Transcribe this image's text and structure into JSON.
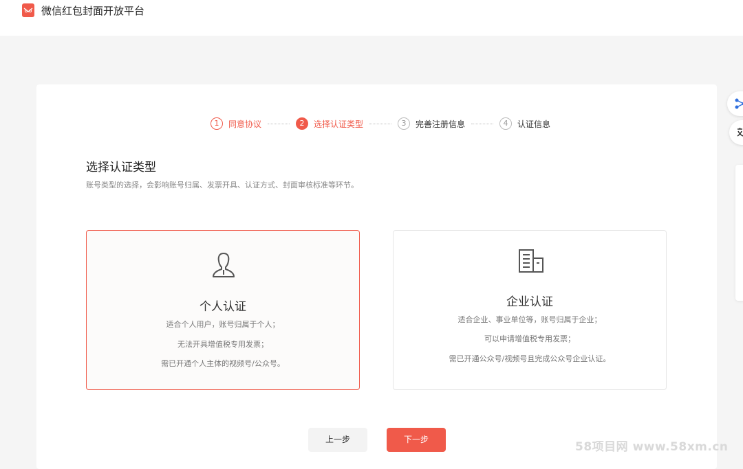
{
  "header": {
    "app_title": "微信红包封面开放平台"
  },
  "steps": [
    {
      "num": "1",
      "label": "同意协议",
      "state": "done"
    },
    {
      "num": "2",
      "label": "选择认证类型",
      "state": "active"
    },
    {
      "num": "3",
      "label": "完善注册信息",
      "state": "pending"
    },
    {
      "num": "4",
      "label": "认证信息",
      "state": "pending"
    }
  ],
  "section": {
    "title": "选择认证类型",
    "desc": "账号类型的选择，会影响账号归属、发票开具、认证方式、封面审核标准等环节。"
  },
  "options": [
    {
      "title": "个人认证",
      "icon": "person-icon",
      "lines": [
        "适合个人用户，账号归属于个人；",
        "无法开具增值税专用发票；",
        "需已开通个人主体的视频号/公众号。"
      ],
      "selected": true
    },
    {
      "title": "企业认证",
      "icon": "building-icon",
      "lines": [
        "适合企业、事业单位等，账号归属于企业；",
        "可以申请增值税专用发票；",
        "需已开通公众号/视频号且完成公众号企业认证。"
      ],
      "selected": false
    }
  ],
  "buttons": {
    "prev": "上一步",
    "next": "下一步"
  },
  "watermark": "58项目网 www.58xm.cn",
  "colors": {
    "accent": "#f05a4a",
    "link_blue": "#2f6fde"
  }
}
